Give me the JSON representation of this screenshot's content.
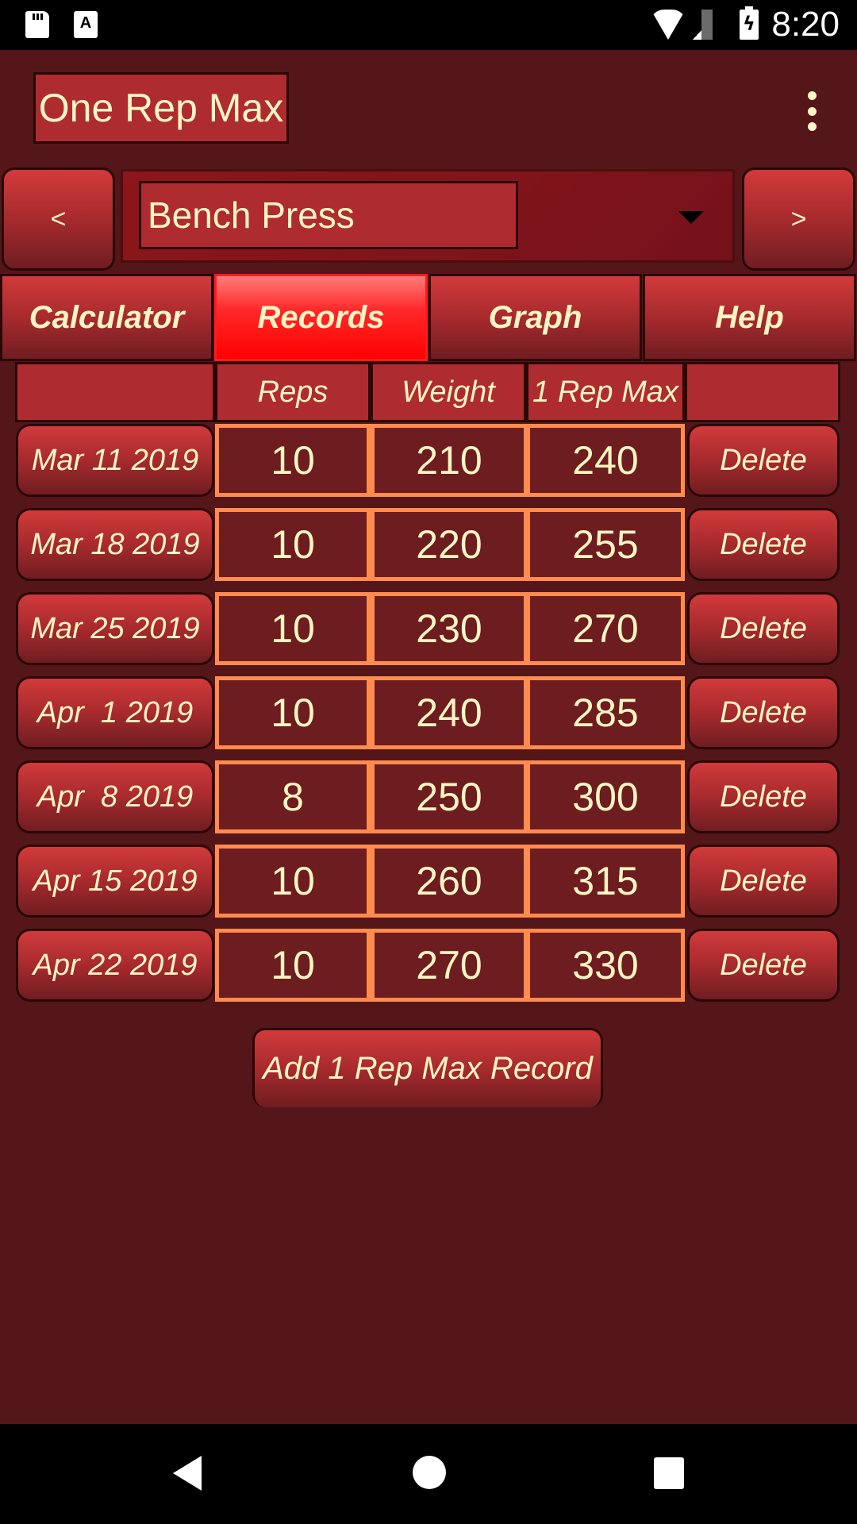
{
  "status_bar": {
    "time": "8:20",
    "icons": [
      "sd-card-icon",
      "accessibility-a-icon",
      "wifi-icon",
      "signal-icon",
      "battery-charging-icon"
    ],
    "a_glyph": "A"
  },
  "app": {
    "title": "One Rep Max",
    "menu_icon": "overflow-menu-icon"
  },
  "exercise_selector": {
    "prev_label": "<",
    "next_label": ">",
    "selected": "Bench Press"
  },
  "tabs": [
    {
      "label": "Calculator",
      "active": false
    },
    {
      "label": "Records",
      "active": true
    },
    {
      "label": "Graph",
      "active": false
    },
    {
      "label": "Help",
      "active": false
    }
  ],
  "table": {
    "headers": [
      "",
      "Reps",
      "Weight",
      "1 Rep Max",
      ""
    ],
    "delete_label": "Delete",
    "rows": [
      {
        "date": "Mar 11 2019",
        "reps": "10",
        "weight": "210",
        "max": "240"
      },
      {
        "date": "Mar 18 2019",
        "reps": "10",
        "weight": "220",
        "max": "255"
      },
      {
        "date": "Mar 25 2019",
        "reps": "10",
        "weight": "230",
        "max": "270"
      },
      {
        "date": "Apr  1 2019",
        "reps": "10",
        "weight": "240",
        "max": "285"
      },
      {
        "date": "Apr  8 2019",
        "reps": "8",
        "weight": "250",
        "max": "300"
      },
      {
        "date": "Apr 15 2019",
        "reps": "10",
        "weight": "260",
        "max": "315"
      },
      {
        "date": "Apr 22 2019",
        "reps": "10",
        "weight": "270",
        "max": "330"
      }
    ]
  },
  "add_button": "Add 1 Rep Max Record",
  "colors": {
    "background": "#55161a",
    "button_red": "#ae2c2f",
    "active_tab": "#ff0000",
    "cell_border": "#ff8c4e",
    "cell_bg": "#6d1d1f",
    "text": "#fdf5c4"
  }
}
